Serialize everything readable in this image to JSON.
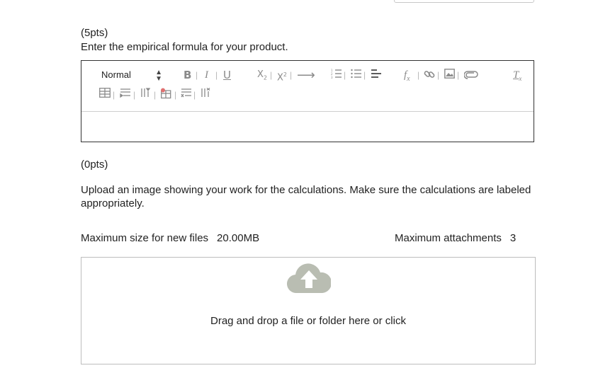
{
  "q1": {
    "points": "(5pts)",
    "prompt": "Enter the empirical formula for your product.",
    "editor": {
      "format_value": "Normal",
      "content": "",
      "toolbar_icons": [
        "bold-icon",
        "italic-icon",
        "underline-icon",
        "subscript-icon",
        "superscript-icon",
        "arrow-right-icon",
        "ordered-list-icon",
        "unordered-list-icon",
        "align-left-icon",
        "formula-icon",
        "link-icon",
        "image-icon",
        "attachment-icon",
        "clear-format-icon",
        "table-icon",
        "table-row-icon",
        "table-column-icon",
        "table-delete-icon",
        "table-row-delete-icon",
        "table-column-delete-icon"
      ]
    }
  },
  "q2": {
    "points": "(0pts)",
    "prompt": "Upload an image showing your work for the calculations. Make sure the calculations are labeled appropriately.",
    "max_size_label": "Maximum size for new files",
    "max_size_value": "20.00MB",
    "max_attach_label": "Maximum attachments",
    "max_attach_value": "3",
    "dropzone_text": "Drag and drop a file or folder here or click"
  },
  "colors": {
    "upload_icon": "#b9bdb2",
    "toolbar_icon": "#8a8a8a",
    "editor_border": "#333333"
  }
}
